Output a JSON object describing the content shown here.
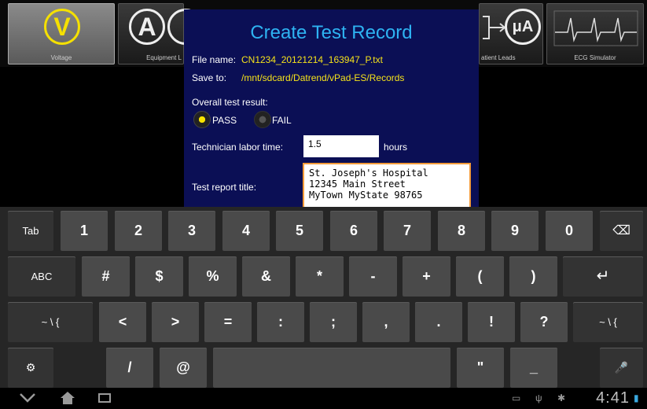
{
  "toolbar": {
    "tools": [
      {
        "glyph": "V",
        "label": "Voltage"
      },
      {
        "glyph": "A",
        "label": "Equipment L"
      },
      {
        "glyph": "μA",
        "label": "atient Leads"
      },
      {
        "glyph": "",
        "label": "ECG Simulator"
      }
    ]
  },
  "dialog": {
    "title": "Create Test Record",
    "file_name_label": "File name:",
    "file_name_value": "CN1234_20121214_163947_P.txt",
    "save_to_label": "Save to:",
    "save_to_value": "/mnt/sdcard/Datrend/vPad-ES/Records",
    "result_label": "Overall test result:",
    "pass_label": "PASS",
    "fail_label": "FAIL",
    "selected_result": "PASS",
    "labor_label": "Technician labor time:",
    "labor_value": "1.5",
    "labor_unit": "hours",
    "report_title_label": "Test report title:",
    "report_title_value": "St. Joseph's Hospital\n12345 Main Street\nMyTown MyState 98765"
  },
  "keyboard": {
    "row1": [
      "Tab",
      "1",
      "2",
      "3",
      "4",
      "5",
      "6",
      "7",
      "8",
      "9",
      "0",
      "⌫"
    ],
    "row2": [
      "ABC",
      "#",
      "$",
      "%",
      "&",
      "*",
      "-",
      "+",
      "(",
      ")",
      "↵"
    ],
    "row3": [
      "~ \\ {",
      "<",
      ">",
      "=",
      ":",
      ";",
      ",",
      ".",
      "!",
      "?",
      "~ \\ {"
    ],
    "row4": [
      "⚙",
      "/",
      "@",
      "",
      "\"",
      "_",
      "🎤"
    ]
  },
  "navbar": {
    "back_icon": "back-chevron-icon",
    "home_icon": "home-icon",
    "recent_icon": "recent-apps-icon",
    "clock": "4:41"
  }
}
